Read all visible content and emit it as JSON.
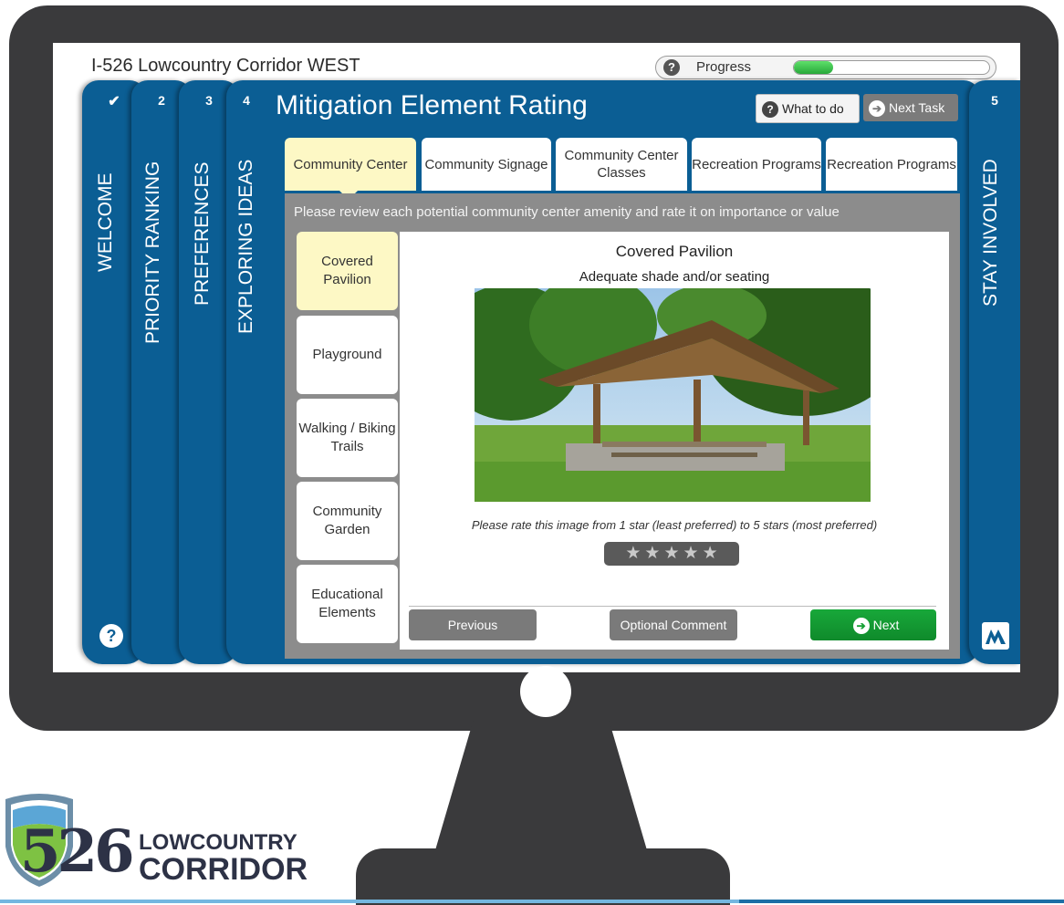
{
  "header": {
    "title": "I-526 Lowcountry Corridor WEST",
    "progress_label": "Progress",
    "progress_fraction": 0.2
  },
  "nav": {
    "welcome_label": "WELCOME",
    "step2_num": "2",
    "step2_label": "PRIORITY RANKING",
    "step3_num": "3",
    "step3_label": "PREFERENCES",
    "step4_num": "4",
    "step4_label": "EXPLORING IDEAS",
    "step5_num": "5",
    "step5_label": "STAY INVOLVED"
  },
  "main": {
    "title": "Mitigation Element Rating",
    "what_to_do": "What to do",
    "next_task": "Next Task",
    "instruction": "Please review each potential community center amenity and rate it on importance or value",
    "tabs": [
      {
        "label": "Community Center"
      },
      {
        "label": "Community Signage"
      },
      {
        "label": "Community Center Classes"
      },
      {
        "label": "Recreation Programs"
      },
      {
        "label": "Recreation Programs"
      }
    ],
    "amenities": [
      {
        "label": "Covered Pavilion"
      },
      {
        "label": "Playground"
      },
      {
        "label": "Walking / Biking Trails"
      },
      {
        "label": "Community Garden"
      },
      {
        "label": "Educational Elements"
      }
    ],
    "detail": {
      "title": "Covered Pavilion",
      "description": "Adequate shade and/or seating",
      "rate_prompt": "Please rate this image from 1 star (least preferred) to 5 stars (most preferred)",
      "rating": 0,
      "max_rating": 5
    },
    "footer": {
      "previous": "Previous",
      "optional_comment": "Optional Comment",
      "next": "Next"
    }
  },
  "logo": {
    "number": "526",
    "line1": "LOWCOUNTRY",
    "line2": "CORRIDOR"
  },
  "colors": {
    "nav_blue": "#0b5e94",
    "active_tab": "#fdf8c5",
    "next_green": "#16a034",
    "monitor": "#3a3a3c"
  }
}
